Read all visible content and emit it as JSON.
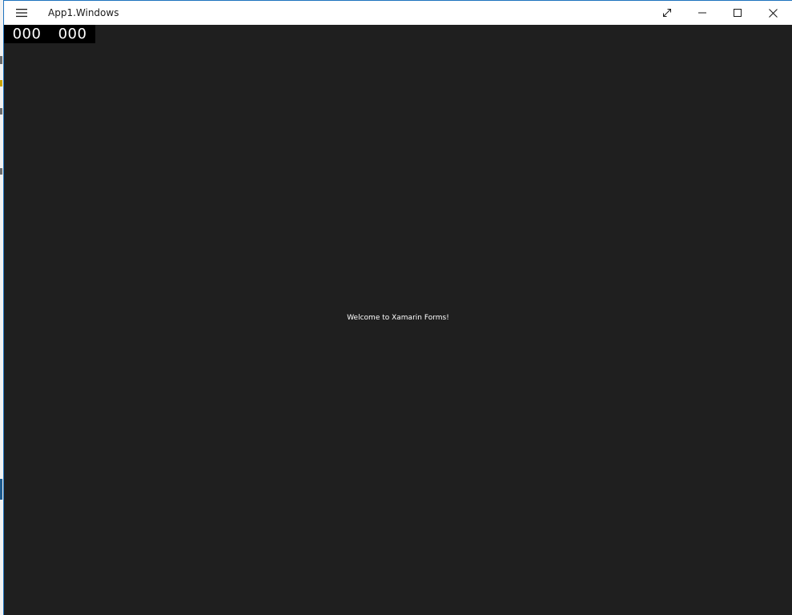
{
  "window": {
    "title": "App1.Windows"
  },
  "titlebar_buttons": {
    "menu": "hamburger-icon",
    "fullscreen": "expand-icon",
    "minimize": "minimize-icon",
    "maximize": "maximize-icon",
    "close": "close-icon"
  },
  "counter": {
    "left_value": "000",
    "right_value": "000"
  },
  "content": {
    "welcome_text": "Welcome to Xamarin Forms!"
  },
  "colors": {
    "content_background": "#1f1f1f",
    "counter_background": "#000000",
    "titlebar_background": "#ffffff",
    "window_border": "#1e73be"
  }
}
